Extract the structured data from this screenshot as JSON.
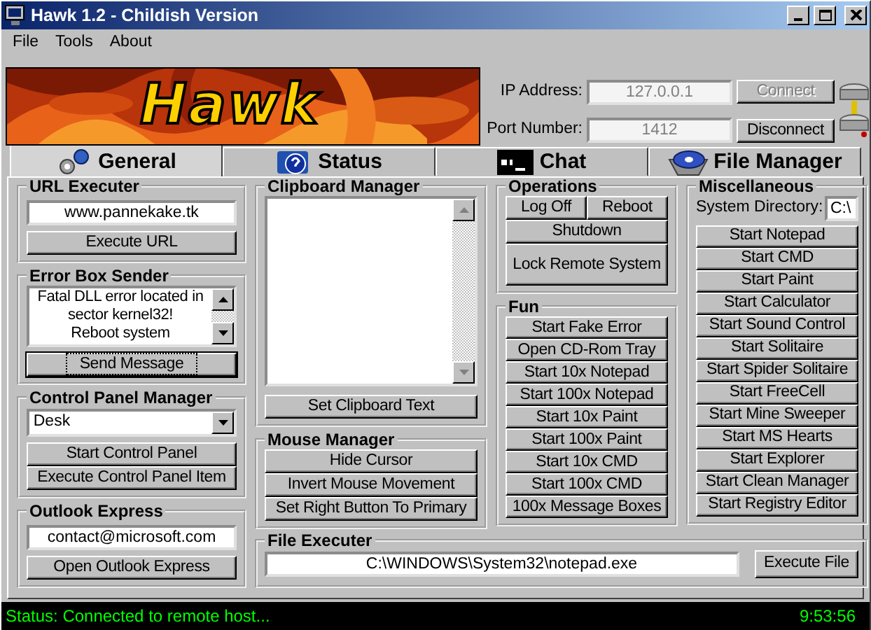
{
  "window": {
    "title": "Hawk 1.2 - Childish Version"
  },
  "menu": [
    "File",
    "Tools",
    "About"
  ],
  "banner": {
    "logo": "Hawk"
  },
  "connection": {
    "ip_label": "IP Address:",
    "ip": "127.0.0.1",
    "port_label": "Port Number:",
    "port": "1412",
    "buttons": [
      {
        "label": "Connect",
        "disabled": true
      },
      {
        "label": "Disconnect",
        "disabled": false
      }
    ]
  },
  "tabs": [
    {
      "label": "General",
      "selected": true
    },
    {
      "label": "Status",
      "selected": false
    },
    {
      "label": "Chat",
      "selected": false
    },
    {
      "label": "File Manager",
      "selected": false
    }
  ],
  "url_executer": {
    "title": "URL Executer",
    "value": "www.pannekake.tk",
    "button": "Execute URL"
  },
  "error_box_sender": {
    "title": "Error Box Sender",
    "text": "Fatal DLL error located in\nsector kernel32!\nReboot system",
    "button": {
      "label": "Send Message",
      "focused": true
    }
  },
  "control_panel_manager": {
    "title": "Control Panel Manager",
    "selected_item": "Desk",
    "buttons": [
      "Start Control Panel",
      "Execute Control Panel Item"
    ]
  },
  "outlook_express": {
    "title": "Outlook Express",
    "value": "contact@microsoft.com",
    "button": "Open Outlook Express"
  },
  "clipboard_manager": {
    "title": "Clipboard Manager",
    "button": "Set Clipboard Text"
  },
  "mouse_manager": {
    "title": "Mouse Manager",
    "buttons": [
      "Hide Cursor",
      "Invert Mouse Movement",
      "Set Right Button To Primary"
    ]
  },
  "operations": {
    "title": "Operations",
    "buttons": [
      "Log Off",
      "Reboot",
      "Shutdown",
      "Lock Remote System"
    ]
  },
  "fun": {
    "title": "Fun",
    "buttons": [
      "Start Fake Error",
      "Open CD-Rom Tray",
      "Start 10x Notepad",
      "Start 100x Notepad",
      "Start 10x Paint",
      "Start 100x Paint",
      "Start 10x CMD",
      "Start 100x CMD",
      "100x Message Boxes"
    ]
  },
  "miscellaneous": {
    "title": "Miscellaneous",
    "directory_label": "System Directory:",
    "directory": "C:\\",
    "buttons": [
      "Start Notepad",
      "Start CMD",
      "Start Paint",
      "Start Calculator",
      "Start Sound Control",
      "Start Solitaire",
      "Start Spider Solitaire",
      "Start FreeCell",
      "Start Mine Sweeper",
      "Start MS Hearts",
      "Start Explorer",
      "Start Clean Manager",
      "Start Registry Editor"
    ]
  },
  "file_executer": {
    "title": "File Executer",
    "value": "C:\\WINDOWS\\System32\\notepad.exe",
    "button": "Execute File"
  },
  "status_bar": {
    "text": "Status: Connected to remote host...",
    "time": "9:53:56"
  }
}
